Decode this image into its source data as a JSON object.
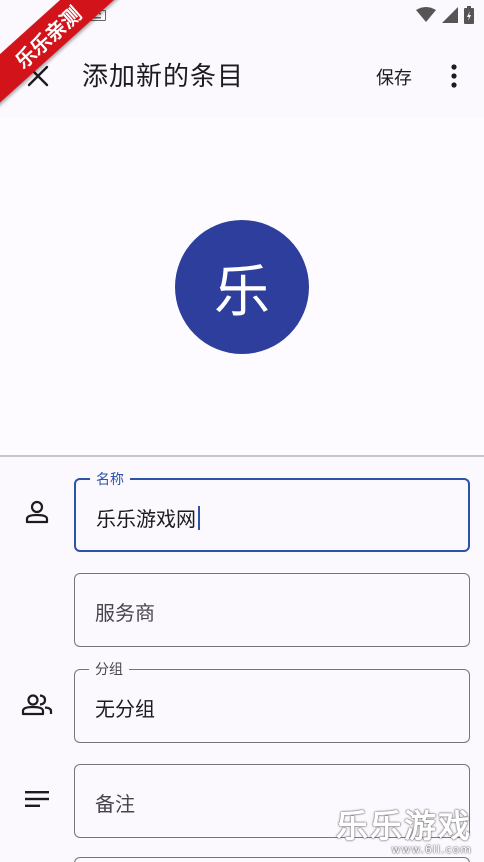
{
  "app_bar": {
    "title": "添加新的条目",
    "save_label": "保存"
  },
  "avatar": {
    "initial": "乐",
    "color": "#2e3e9c"
  },
  "form": {
    "name": {
      "label": "名称",
      "value": "乐乐游戏网"
    },
    "provider": {
      "placeholder": "服务商"
    },
    "group": {
      "label": "分组",
      "value": "无分组"
    },
    "notes": {
      "placeholder": "备注"
    }
  },
  "icons": {
    "close": "close-icon",
    "more": "more-vert-icon",
    "person": "person-icon",
    "group": "group-icon",
    "notes": "notes-icon"
  },
  "overlay": {
    "ribbon_text": "乐乐亲测",
    "watermark_main": "乐乐游戏",
    "watermark_sub": "www.6ll.com"
  },
  "colors": {
    "accent": "#2b54a8",
    "ribbon": "#d2141a"
  }
}
